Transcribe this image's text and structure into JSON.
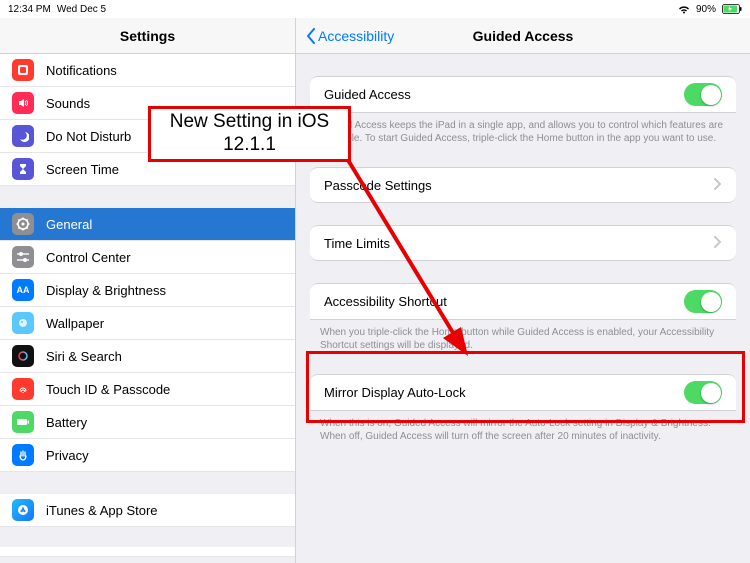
{
  "statusbar": {
    "time": "12:34 PM",
    "date": "Wed Dec 5",
    "battery_pct": "90%"
  },
  "sidebar": {
    "title": "Settings",
    "items": [
      {
        "label": "Notifications"
      },
      {
        "label": "Sounds"
      },
      {
        "label": "Do Not Disturb"
      },
      {
        "label": "Screen Time"
      },
      {
        "label": "General"
      },
      {
        "label": "Control Center"
      },
      {
        "label": "Display & Brightness"
      },
      {
        "label": "Wallpaper"
      },
      {
        "label": "Siri & Search"
      },
      {
        "label": "Touch ID & Passcode"
      },
      {
        "label": "Battery"
      },
      {
        "label": "Privacy"
      },
      {
        "label": "iTunes & App Store"
      }
    ]
  },
  "content": {
    "back_label": "Accessibility",
    "title": "Guided Access",
    "groups": {
      "guided_access": {
        "label": "Guided Access",
        "footer": "Guided Access keeps the iPad in a single app, and allows you to control which features are available. To start Guided Access, triple-click the Home button in the app you want to use."
      },
      "passcode": {
        "label": "Passcode Settings"
      },
      "time_limits": {
        "label": "Time Limits"
      },
      "shortcut": {
        "label": "Accessibility Shortcut",
        "footer": "When you triple-click the Home button while Guided Access is enabled, your Accessibility Shortcut settings will be displayed."
      },
      "mirror": {
        "label": "Mirror Display Auto-Lock",
        "footer": "When this is on, Guided Access will mirror the Auto-Lock setting in Display & Brightness. When off, Guided Access will turn off the screen after 20 minutes of inactivity."
      }
    }
  },
  "annotation": {
    "callout": "New Setting in iOS 12.1.1"
  }
}
